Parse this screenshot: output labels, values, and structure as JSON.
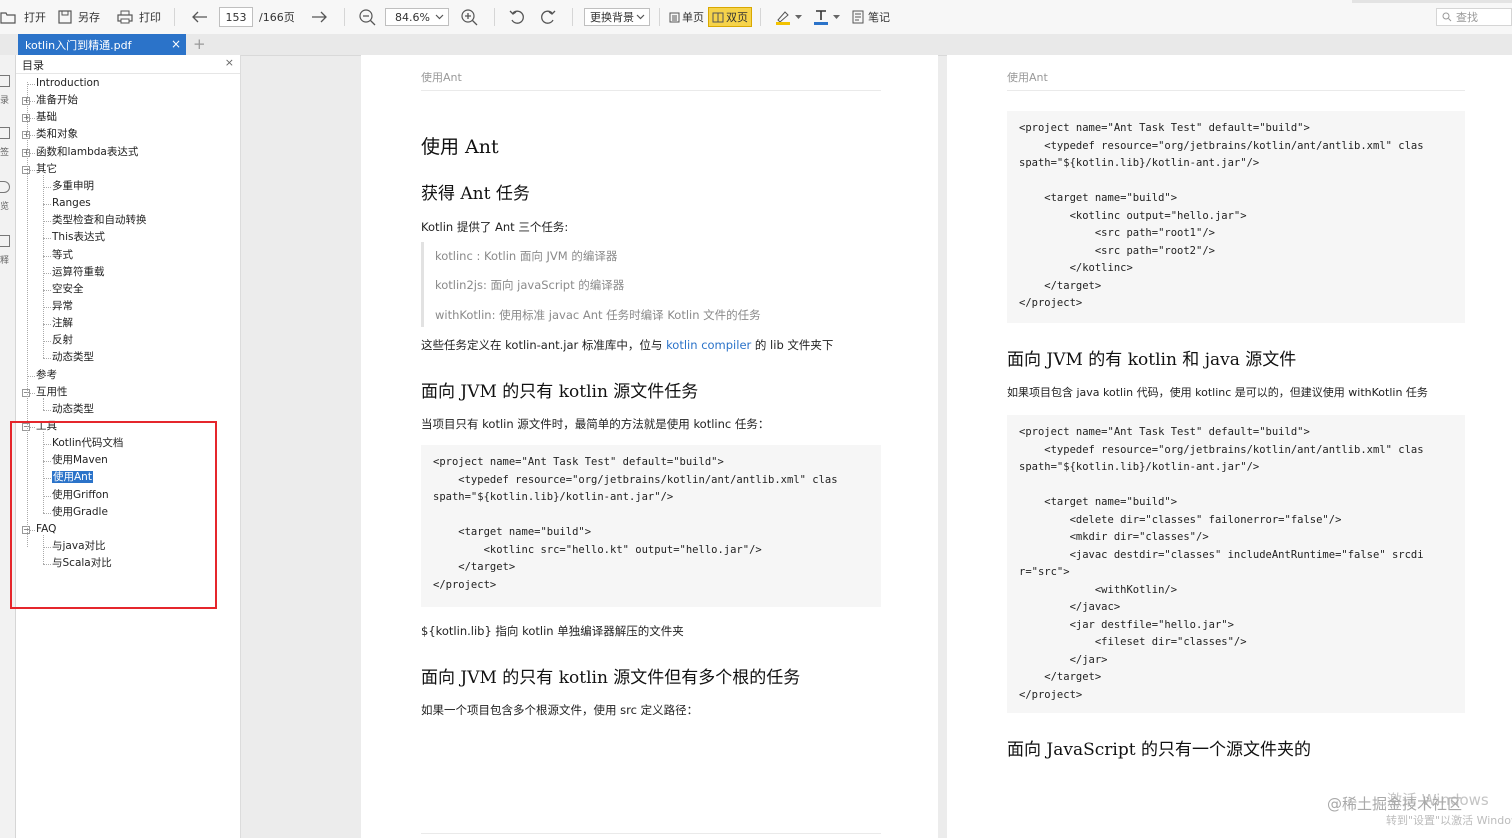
{
  "toolbar": {
    "open": "打开",
    "save_as": "另存",
    "print": "打印",
    "current_page": "153",
    "total_pages": "/166页",
    "zoom": "84.6%",
    "background": "更换背景",
    "single_page": "单页",
    "double_page": "双页",
    "notes": "笔记",
    "search_placeholder": "查找"
  },
  "document_tab": {
    "title": "kotlin入门到精通.pdf",
    "close": "×",
    "new_tab": "+"
  },
  "left_rail": [
    "录",
    "签",
    "览",
    "释"
  ],
  "toc": {
    "title": "目录",
    "close": "×",
    "items": [
      {
        "label": "Introduction"
      },
      {
        "label": "准备开始"
      },
      {
        "label": "基础"
      },
      {
        "label": "类和对象"
      },
      {
        "label": "函数和lambda表达式"
      },
      {
        "label": "其它"
      },
      {
        "label": "多重申明"
      },
      {
        "label": "Ranges"
      },
      {
        "label": "类型检查和自动转换"
      },
      {
        "label": "This表达式"
      },
      {
        "label": "等式"
      },
      {
        "label": "运算符重载"
      },
      {
        "label": "空安全"
      },
      {
        "label": "异常"
      },
      {
        "label": "注解"
      },
      {
        "label": "反射"
      },
      {
        "label": "动态类型"
      },
      {
        "label": "参考"
      },
      {
        "label": "互用性"
      },
      {
        "label": "动态类型"
      },
      {
        "label": "工具"
      },
      {
        "label": "Kotlin代码文档"
      },
      {
        "label": "使用Maven"
      },
      {
        "label": "使用Ant"
      },
      {
        "label": "使用Griffon"
      },
      {
        "label": "使用Gradle"
      },
      {
        "label": "FAQ"
      },
      {
        "label": "与java对比"
      },
      {
        "label": "与Scala对比"
      }
    ]
  },
  "left_page": {
    "header": "使用Ant",
    "title": "使用 Ant",
    "h_get": "获得 Ant 任务",
    "intro": "Kotlin 提供了 Ant 三个任务:",
    "tasks": [
      "kotlinc : Kotlin 面向 JVM 的编译器",
      "kotlin2js: 面向 javaScript 的编译器",
      "withKotlin: 使用标准 javac Ant 任务时编译 Kotlin 文件的任务"
    ],
    "lib_pre": "这些任务定义在 kotlin-ant.jar 标准库中，位与",
    "lib_link": "kotlin compiler",
    "lib_post": "的 lib 文件夹下",
    "h_jvm": "面向 JVM 的只有 kotlin 源文件任务",
    "jvm_text": "当项目只有 kotlin 源文件时，最简单的方法就是使用 kotlinc 任务：",
    "code1": "<project name=\"Ant Task Test\" default=\"build\">\n    <typedef resource=\"org/jetbrains/kotlin/ant/antlib.xml\" clas\nspath=\"${kotlin.lib}/kotlin-ant.jar\"/>\n\n    <target name=\"build\">\n        <kotlinc src=\"hello.kt\" output=\"hello.jar\"/>\n    </target>\n</project>",
    "lib_note": "${kotlin.lib} 指向 kotlin 单独编译器解压的文件夹",
    "h_multi": "面向 JVM 的只有 kotlin 源文件但有多个根的任务",
    "multi_text": "如果一个项目包含多个根源文件，使用 src 定义路径："
  },
  "right_page": {
    "header": "使用Ant",
    "code1": "<project name=\"Ant Task Test\" default=\"build\">\n    <typedef resource=\"org/jetbrains/kotlin/ant/antlib.xml\" clas\nspath=\"${kotlin.lib}/kotlin-ant.jar\"/>\n\n    <target name=\"build\">\n        <kotlinc output=\"hello.jar\">\n            <src path=\"root1\"/>\n            <src path=\"root2\"/>\n        </kotlinc>\n    </target>\n</project>",
    "h_mixed": "面向 JVM 的有 kotlin 和 java 源文件",
    "mixed_text": "如果项目包含 java kotlin 代码，使用 kotlinc 是可以的，但建议使用 withKotlin 任务",
    "code2": "<project name=\"Ant Task Test\" default=\"build\">\n    <typedef resource=\"org/jetbrains/kotlin/ant/antlib.xml\" clas\nspath=\"${kotlin.lib}/kotlin-ant.jar\"/>\n\n    <target name=\"build\">\n        <delete dir=\"classes\" failonerror=\"false\"/>\n        <mkdir dir=\"classes\"/>\n        <javac destdir=\"classes\" includeAntRuntime=\"false\" srcdi\nr=\"src\">\n            <withKotlin/>\n        </javac>\n        <jar destfile=\"hello.jar\">\n            <fileset dir=\"classes\"/>\n        </jar>\n    </target>\n</project>",
    "h_js": "面向 JavaScript 的只有一个源文件夹的"
  },
  "watermark": {
    "community": "@稀土掘金技术社区",
    "activate_1": "激活 Windows",
    "activate_2": "转到\"设置\"以激活 Windows"
  },
  "colors": {
    "accent": "#2b73c9",
    "highlight_box": "#e5262c",
    "selected_mode": "#f6d34a"
  }
}
